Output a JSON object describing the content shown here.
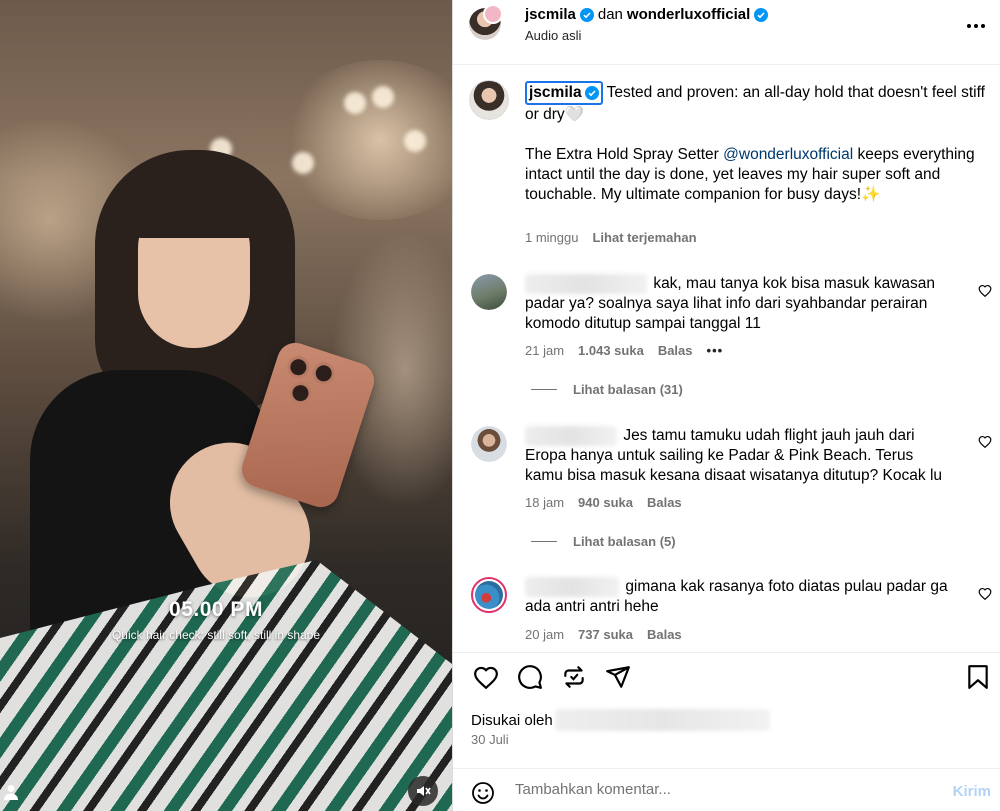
{
  "video": {
    "overlay_time": "05.00 PM",
    "overlay_caption": "Quick hair check: still soft, still in shape"
  },
  "header": {
    "author": "jscmila",
    "connector": "dan",
    "collab": "wonderluxofficial",
    "audio": "Audio asli"
  },
  "caption": {
    "username": "jscmila",
    "line1": "Tested and proven: an all-day hold that doesn't feel stiff or dry",
    "heart_emoji": "🤍",
    "para2_start": "The Extra Hold Spray Setter ",
    "mention": "@wonderluxofficial",
    "para2_end": " keeps everything intact until the day is done, yet leaves my hair super soft and touchable. My ultimate companion for busy days!",
    "sparkle_emoji": "✨",
    "age": "1 minggu",
    "translate": "Lihat terjemahan"
  },
  "comments": [
    {
      "text": "kak, mau tanya kok bisa masuk kawasan padar ya? soalnya saya lihat info dari syahbandar perairan komodo ditutup sampai tanggal 11",
      "age": "21 jam",
      "likes": "1.043 suka",
      "reply": "Balas",
      "more": "•••",
      "view_replies": "Lihat balasan (31)"
    },
    {
      "text": "Jes tamu tamuku udah flight jauh jauh dari Eropa hanya untuk sailing ke Padar & Pink Beach. Terus kamu bisa masuk kesana disaat wisatanya ditutup? Kocak lu",
      "age": "18 jam",
      "likes": "940 suka",
      "reply": "Balas",
      "view_replies": "Lihat balasan (5)"
    },
    {
      "text": "gimana kak rasanya foto diatas pulau padar ga ada antri antri hehe",
      "age": "20 jam",
      "likes": "737 suka",
      "reply": "Balas"
    }
  ],
  "footer": {
    "liked_by": "Disukai oleh",
    "date": "30 Juli",
    "add_comment_placeholder": "Tambahkan komentar...",
    "send": "Kirim"
  },
  "colors": {
    "verified": "#0095f6",
    "link": "#00376b",
    "muted": "#737373",
    "send_disabled": "#b3d3f5"
  }
}
